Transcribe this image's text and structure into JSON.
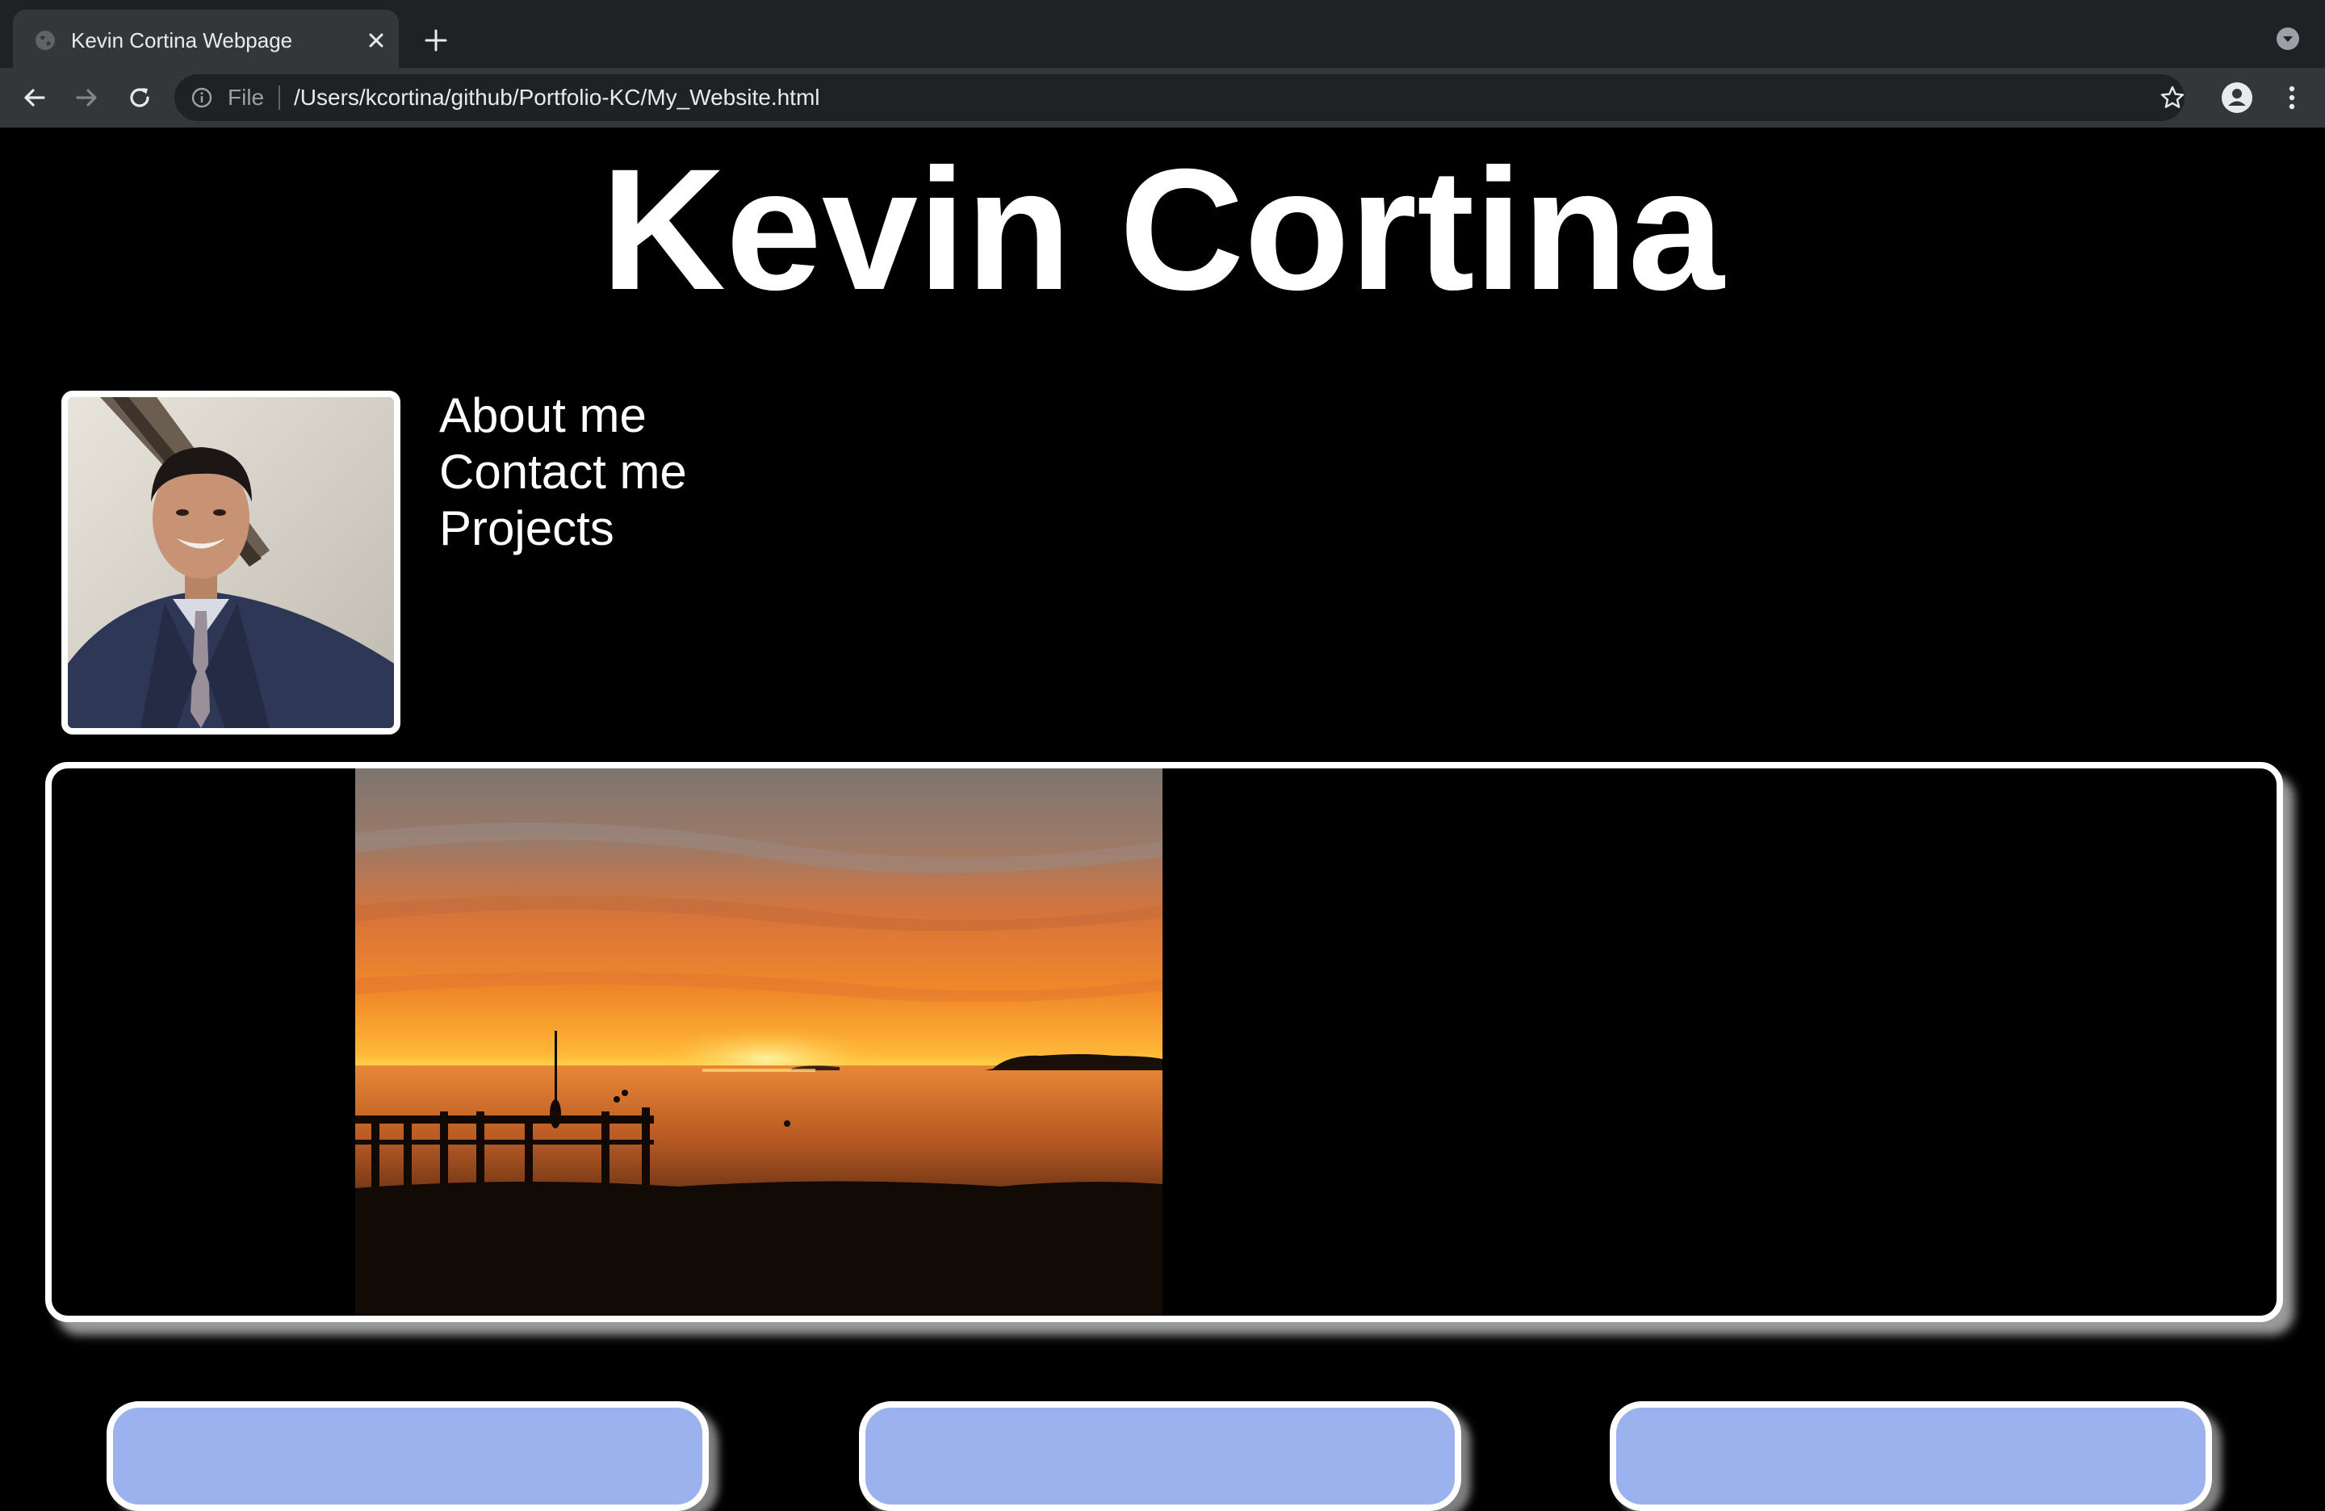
{
  "browser": {
    "tab_title": "Kevin Cortina Webpage",
    "scheme_label": "File",
    "url": "/Users/kcortina/github/Portfolio-KC/My_Website.html",
    "icons": {
      "favicon": "globe-icon",
      "close": "close-icon",
      "new_tab": "plus-icon",
      "tab_search": "chevron-down-icon",
      "back": "back-arrow-icon",
      "forward": "forward-arrow-icon",
      "reload": "reload-icon",
      "info": "info-icon",
      "bookmark": "star-icon",
      "profile": "profile-icon",
      "menu": "kebab-menu-icon"
    }
  },
  "page": {
    "title": "Kevin Cortina",
    "nav": [
      {
        "label": "About me"
      },
      {
        "label": "Contact me"
      },
      {
        "label": "Projects"
      }
    ],
    "card_color": "#9bb2ef",
    "background": "#000000"
  }
}
